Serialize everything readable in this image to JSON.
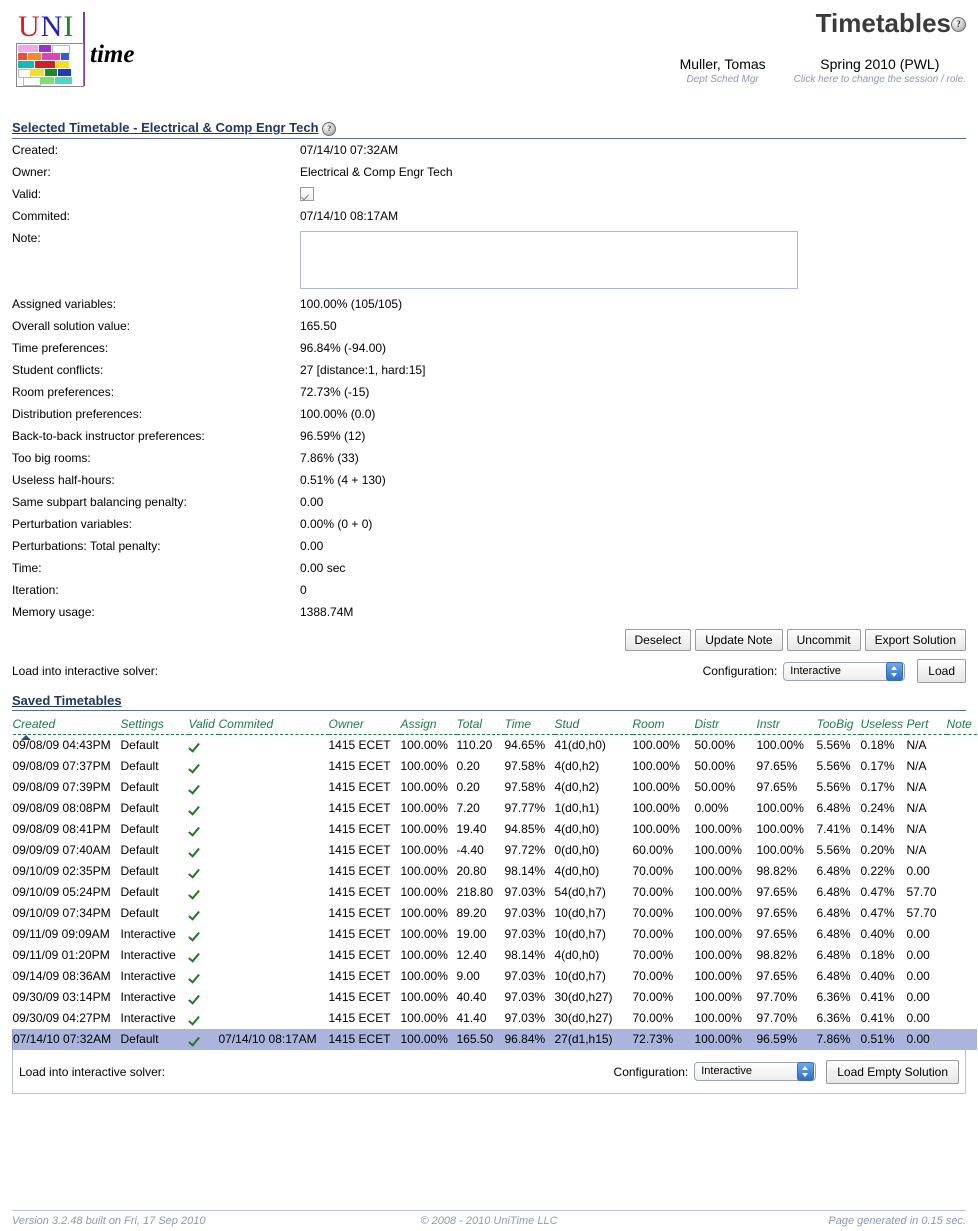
{
  "header": {
    "logo_uni": [
      "U",
      "N",
      "I"
    ],
    "logo_time": "time",
    "title": "Timetables",
    "help_glyph": "?",
    "user_name": "Muller, Tomas",
    "user_role": "Dept Sched Mgr",
    "session_name": "Spring 2010 (PWL)",
    "session_hint": "Click here to change the session / role."
  },
  "selected": {
    "section_title": "Selected Timetable - Electrical & Comp Engr Tech",
    "rows": [
      {
        "label": "Created:",
        "value": "07/14/10 07:32AM",
        "type": "text"
      },
      {
        "label": "Owner:",
        "value": "Electrical & Comp Engr Tech",
        "type": "text"
      },
      {
        "label": "Valid:",
        "value": "",
        "type": "checkbox"
      },
      {
        "label": "Commited:",
        "value": "07/14/10 08:17AM",
        "type": "text"
      },
      {
        "label": "Note:",
        "value": "",
        "type": "textarea"
      },
      {
        "label": "Assigned variables:",
        "value": "100.00% (105/105)",
        "type": "text"
      },
      {
        "label": "Overall solution value:",
        "value": "165.50",
        "type": "text"
      },
      {
        "label": "Time preferences:",
        "value": "96.84% (-94.00)",
        "type": "text"
      },
      {
        "label": "Student conflicts:",
        "value": "27 [distance:1, hard:15]",
        "type": "text"
      },
      {
        "label": "Room preferences:",
        "value": "72.73% (-15)",
        "type": "text"
      },
      {
        "label": "Distribution preferences:",
        "value": "100.00% (0.0)",
        "type": "text"
      },
      {
        "label": "Back-to-back instructor preferences:",
        "value": "96.59% (12)",
        "type": "text"
      },
      {
        "label": "Too big rooms:",
        "value": "7.86% (33)",
        "type": "text"
      },
      {
        "label": "Useless half-hours:",
        "value": "0.51% (4 + 130)",
        "type": "text"
      },
      {
        "label": "Same subpart balancing penalty:",
        "value": "0.00",
        "type": "text"
      },
      {
        "label": "Perturbation variables:",
        "value": "0.00% (0 + 0)",
        "type": "text"
      },
      {
        "label": "Perturbations: Total penalty:",
        "value": "0.00",
        "type": "text"
      },
      {
        "label": "Time:",
        "value": "0.00 sec",
        "type": "text"
      },
      {
        "label": "Iteration:",
        "value": "0",
        "type": "text"
      },
      {
        "label": "Memory usage:",
        "value": "1388.74M",
        "type": "text"
      }
    ],
    "note_value": "",
    "note_placeholder": ""
  },
  "actions": {
    "deselect": "Deselect",
    "update_note": "Update Note",
    "uncommit": "Uncommit",
    "export_solution": "Export Solution"
  },
  "loader_top": {
    "label": "Load into interactive solver:",
    "config_label": "Configuration:",
    "config_value": "Interactive",
    "load_button": "Load"
  },
  "loader_bottom": {
    "label": "Load into interactive solver:",
    "config_label": "Configuration:",
    "config_value": "Interactive",
    "load_button": "Load Empty Solution"
  },
  "saved": {
    "section_title": "Saved Timetables",
    "sorted_column": "Created",
    "columns": [
      "Created",
      "Settings",
      "Valid",
      "Commited",
      "Owner",
      "Assign",
      "Total",
      "Time",
      "Stud",
      "Room",
      "Distr",
      "Instr",
      "TooBig",
      "Useless",
      "Pert",
      "Note"
    ],
    "rows": [
      {
        "created": "09/08/09 04:43PM",
        "settings": "Default",
        "valid": true,
        "commited": "",
        "owner": "1415 ECET",
        "assign": "100.00%",
        "total": "110.20",
        "time": "94.65%",
        "stud": "41(d0,h0)",
        "room": "100.00%",
        "distr": "50.00%",
        "instr": "100.00%",
        "toobig": "5.56%",
        "useless": "0.18%",
        "pert": "N/A",
        "note": "",
        "selected": false
      },
      {
        "created": "09/08/09 07:37PM",
        "settings": "Default",
        "valid": true,
        "commited": "",
        "owner": "1415 ECET",
        "assign": "100.00%",
        "total": "0.20",
        "time": "97.58%",
        "stud": "4(d0,h2)",
        "room": "100.00%",
        "distr": "50.00%",
        "instr": "97.65%",
        "toobig": "5.56%",
        "useless": "0.17%",
        "pert": "N/A",
        "note": "",
        "selected": false
      },
      {
        "created": "09/08/09 07:39PM",
        "settings": "Default",
        "valid": true,
        "commited": "",
        "owner": "1415 ECET",
        "assign": "100.00%",
        "total": "0.20",
        "time": "97.58%",
        "stud": "4(d0,h2)",
        "room": "100.00%",
        "distr": "50.00%",
        "instr": "97.65%",
        "toobig": "5.56%",
        "useless": "0.17%",
        "pert": "N/A",
        "note": "",
        "selected": false
      },
      {
        "created": "09/08/09 08:08PM",
        "settings": "Default",
        "valid": true,
        "commited": "",
        "owner": "1415 ECET",
        "assign": "100.00%",
        "total": "7.20",
        "time": "97.77%",
        "stud": "1(d0,h1)",
        "room": "100.00%",
        "distr": "0.00%",
        "instr": "100.00%",
        "toobig": "6.48%",
        "useless": "0.24%",
        "pert": "N/A",
        "note": "",
        "selected": false
      },
      {
        "created": "09/08/09 08:41PM",
        "settings": "Default",
        "valid": true,
        "commited": "",
        "owner": "1415 ECET",
        "assign": "100.00%",
        "total": "19.40",
        "time": "94.85%",
        "stud": "4(d0,h0)",
        "room": "100.00%",
        "distr": "100.00%",
        "instr": "100.00%",
        "toobig": "7.41%",
        "useless": "0.14%",
        "pert": "N/A",
        "note": "",
        "selected": false
      },
      {
        "created": "09/09/09 07:40AM",
        "settings": "Default",
        "valid": true,
        "commited": "",
        "owner": "1415 ECET",
        "assign": "100.00%",
        "total": "-4.40",
        "time": "97.72%",
        "stud": "0(d0,h0)",
        "room": "60.00%",
        "distr": "100.00%",
        "instr": "100.00%",
        "toobig": "5.56%",
        "useless": "0.20%",
        "pert": "N/A",
        "note": "",
        "selected": false
      },
      {
        "created": "09/10/09 02:35PM",
        "settings": "Default",
        "valid": true,
        "commited": "",
        "owner": "1415 ECET",
        "assign": "100.00%",
        "total": "20.80",
        "time": "98.14%",
        "stud": "4(d0,h0)",
        "room": "70.00%",
        "distr": "100.00%",
        "instr": "98.82%",
        "toobig": "6.48%",
        "useless": "0.22%",
        "pert": "0.00",
        "note": "",
        "selected": false
      },
      {
        "created": "09/10/09 05:24PM",
        "settings": "Default",
        "valid": true,
        "commited": "",
        "owner": "1415 ECET",
        "assign": "100.00%",
        "total": "218.80",
        "time": "97.03%",
        "stud": "54(d0,h7)",
        "room": "70.00%",
        "distr": "100.00%",
        "instr": "97.65%",
        "toobig": "6.48%",
        "useless": "0.47%",
        "pert": "57.70",
        "note": "",
        "selected": false
      },
      {
        "created": "09/10/09 07:34PM",
        "settings": "Default",
        "valid": true,
        "commited": "",
        "owner": "1415 ECET",
        "assign": "100.00%",
        "total": "89.20",
        "time": "97.03%",
        "stud": "10(d0,h7)",
        "room": "70.00%",
        "distr": "100.00%",
        "instr": "97.65%",
        "toobig": "6.48%",
        "useless": "0.47%",
        "pert": "57.70",
        "note": "",
        "selected": false
      },
      {
        "created": "09/11/09 09:09AM",
        "settings": "Interactive",
        "valid": true,
        "commited": "",
        "owner": "1415 ECET",
        "assign": "100.00%",
        "total": "19.00",
        "time": "97.03%",
        "stud": "10(d0,h7)",
        "room": "70.00%",
        "distr": "100.00%",
        "instr": "97.65%",
        "toobig": "6.48%",
        "useless": "0.40%",
        "pert": "0.00",
        "note": "",
        "selected": false
      },
      {
        "created": "09/11/09 01:20PM",
        "settings": "Interactive",
        "valid": true,
        "commited": "",
        "owner": "1415 ECET",
        "assign": "100.00%",
        "total": "12.40",
        "time": "98.14%",
        "stud": "4(d0,h0)",
        "room": "70.00%",
        "distr": "100.00%",
        "instr": "98.82%",
        "toobig": "6.48%",
        "useless": "0.18%",
        "pert": "0.00",
        "note": "",
        "selected": false
      },
      {
        "created": "09/14/09 08:36AM",
        "settings": "Interactive",
        "valid": true,
        "commited": "",
        "owner": "1415 ECET",
        "assign": "100.00%",
        "total": "9.00",
        "time": "97.03%",
        "stud": "10(d0,h7)",
        "room": "70.00%",
        "distr": "100.00%",
        "instr": "97.65%",
        "toobig": "6.48%",
        "useless": "0.40%",
        "pert": "0.00",
        "note": "",
        "selected": false
      },
      {
        "created": "09/30/09 03:14PM",
        "settings": "Interactive",
        "valid": true,
        "commited": "",
        "owner": "1415 ECET",
        "assign": "100.00%",
        "total": "40.40",
        "time": "97.03%",
        "stud": "30(d0,h27)",
        "room": "70.00%",
        "distr": "100.00%",
        "instr": "97.70%",
        "toobig": "6.36%",
        "useless": "0.41%",
        "pert": "0.00",
        "note": "",
        "selected": false
      },
      {
        "created": "09/30/09 04:27PM",
        "settings": "Interactive",
        "valid": true,
        "commited": "",
        "owner": "1415 ECET",
        "assign": "100.00%",
        "total": "41.40",
        "time": "97.03%",
        "stud": "30(d0,h27)",
        "room": "70.00%",
        "distr": "100.00%",
        "instr": "97.70%",
        "toobig": "6.36%",
        "useless": "0.41%",
        "pert": "0.00",
        "note": "",
        "selected": false
      },
      {
        "created": "07/14/10 07:32AM",
        "settings": "Default",
        "valid": true,
        "commited": "07/14/10 08:17AM",
        "owner": "1415 ECET",
        "assign": "100.00%",
        "total": "165.50",
        "time": "96.84%",
        "stud": "27(d1,h15)",
        "room": "72.73%",
        "distr": "100.00%",
        "instr": "96.59%",
        "toobig": "7.86%",
        "useless": "0.51%",
        "pert": "0.00",
        "note": "",
        "selected": true
      }
    ]
  },
  "footer": {
    "version": "Version 3.2.48 built on Fri, 17 Sep 2010",
    "copyright": "© 2008 - 2010 UniTime LLC",
    "generated": "Page generated in 0.15 sec."
  },
  "colors": {
    "section_title": "#1f3864",
    "table_header": "#1f7a4d",
    "selected_row": "#aab4dc",
    "footer_text": "#8a9ab5",
    "check_green": "#1f7a22"
  }
}
